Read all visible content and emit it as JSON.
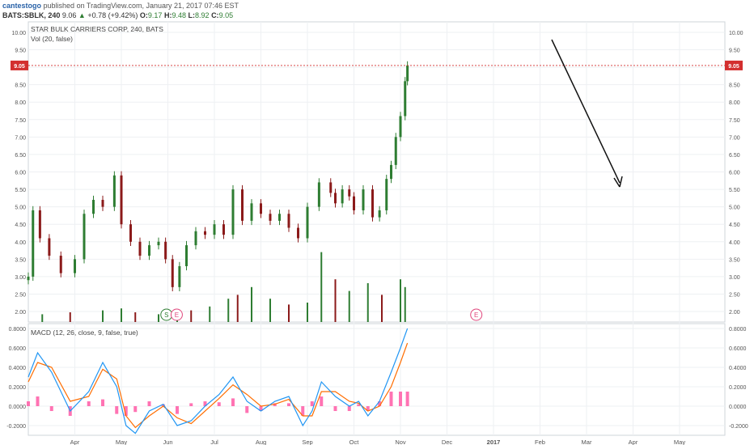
{
  "header": {
    "user": "cantestogo",
    "published": "published on TradingView.com, January 21, 2017 07:46 EST",
    "symbol": "BATS:SBLK, 240",
    "last": "9.06",
    "change": "+0.78 (+9.42%)",
    "open_label": "O:",
    "open": "9.17",
    "high_label": "H:",
    "high": "9.48",
    "low_label": "L:",
    "low": "8.92",
    "close_label": "C:",
    "close": "9.05",
    "up_icon": "triangle-up-icon"
  },
  "main_pane": {
    "title": "STAR BULK CARRIERS CORP, 240, BATS",
    "volume_label": "Vol (20, false)",
    "price_marker": "9.05"
  },
  "macd_pane": {
    "label": "MACD (12, 26, close, 9, false, true)"
  },
  "events": [
    {
      "letter": "S",
      "color": "#2e7d32",
      "x_month": 4.97
    },
    {
      "letter": "E",
      "color": "#e0467c",
      "x_month": 5.19
    },
    {
      "letter": "E",
      "color": "#e0467c",
      "x_month": 11.63
    }
  ],
  "colors": {
    "up": "#2e7d32",
    "down": "#8b1a1a",
    "macd": "#2196f3",
    "signal": "#ff6d00",
    "hist": "#ff5ba6",
    "marker": "#d32f2f"
  },
  "chart_data": [
    {
      "type": "candlestick",
      "title": "STAR BULK CARRIERS CORP, 240, BATS",
      "x_ticks": [
        "Apr",
        "May",
        "Jun",
        "Jul",
        "Aug",
        "Sep",
        "Oct",
        "Nov",
        "Dec",
        "2017",
        "Feb",
        "Mar",
        "Apr",
        "May"
      ],
      "y_ticks": [
        "2.00",
        "2.50",
        "3.00",
        "3.50",
        "4.00",
        "4.50",
        "5.00",
        "5.50",
        "6.00",
        "6.50",
        "7.00",
        "7.50",
        "8.00",
        "8.50",
        "9.00",
        "9.50",
        "10.00"
      ],
      "ylim": [
        1.7,
        10.3
      ],
      "series": [
        {
          "x_month": [
            2.0,
            2.1,
            2.25,
            2.45,
            2.7,
            3.0,
            3.2,
            3.4,
            3.6,
            3.85,
            4.0,
            4.2,
            4.4,
            4.6,
            4.8,
            4.95,
            5.1,
            5.25,
            5.4,
            5.6,
            5.8,
            6.0,
            6.2,
            6.4,
            6.6,
            6.8,
            7.0,
            7.2,
            7.4,
            7.6,
            7.8,
            8.0,
            8.25,
            8.5,
            8.6,
            8.75,
            8.9,
            9.0,
            9.2,
            9.4,
            9.55,
            9.7,
            9.8,
            9.9,
            10.0,
            10.1,
            10.15
          ],
          "close": [
            3.0,
            4.9,
            4.1,
            3.6,
            3.1,
            3.5,
            4.8,
            5.2,
            5.0,
            5.9,
            4.5,
            4.0,
            3.6,
            3.9,
            4.0,
            3.5,
            2.7,
            3.3,
            3.9,
            4.3,
            4.2,
            4.5,
            4.2,
            5.5,
            4.6,
            5.1,
            4.8,
            4.6,
            4.8,
            4.4,
            4.1,
            5.0,
            5.7,
            5.4,
            5.1,
            5.5,
            5.3,
            4.9,
            5.5,
            4.7,
            4.9,
            5.8,
            6.2,
            7.0,
            7.6,
            8.6,
            9.05
          ]
        }
      ]
    },
    {
      "type": "bar",
      "title": "Vol (20, false)",
      "x_month": [
        2.3,
        2.9,
        3.6,
        4.0,
        4.3,
        4.8,
        5.2,
        5.5,
        5.9,
        6.3,
        6.5,
        6.8,
        7.2,
        7.6,
        8.0,
        8.3,
        8.6,
        8.9,
        9.3,
        9.6,
        10.0,
        10.1
      ],
      "values": [
        0.2,
        0.25,
        0.3,
        0.35,
        0.25,
        0.2,
        0.25,
        0.3,
        0.4,
        0.6,
        0.7,
        0.9,
        0.6,
        0.45,
        0.5,
        1.8,
        1.1,
        0.8,
        1.0,
        0.7,
        1.1,
        0.9
      ]
    },
    {
      "type": "line",
      "title": "MACD (12, 26, close, 9, false, true)",
      "y_ticks": [
        "-0.2000",
        "0.0000",
        "0.2000",
        "0.4000",
        "0.6000",
        "0.8000"
      ],
      "ylim": [
        -0.3,
        0.85
      ],
      "x_month": [
        2.0,
        2.2,
        2.5,
        2.9,
        3.3,
        3.6,
        3.9,
        4.1,
        4.3,
        4.6,
        4.9,
        5.2,
        5.5,
        5.8,
        6.1,
        6.4,
        6.7,
        7.0,
        7.3,
        7.6,
        7.9,
        8.1,
        8.3,
        8.6,
        8.9,
        9.1,
        9.3,
        9.55,
        9.8,
        10.0,
        10.15
      ],
      "series": [
        {
          "name": "MACD",
          "values": [
            0.3,
            0.55,
            0.35,
            -0.05,
            0.15,
            0.45,
            0.2,
            -0.2,
            -0.28,
            -0.05,
            0.02,
            -0.2,
            -0.15,
            0.0,
            0.12,
            0.3,
            0.05,
            -0.05,
            0.05,
            0.1,
            -0.2,
            -0.05,
            0.25,
            0.1,
            0.0,
            0.05,
            -0.1,
            0.05,
            0.35,
            0.6,
            0.8
          ]
        },
        {
          "name": "Signal",
          "values": [
            0.25,
            0.45,
            0.4,
            0.05,
            0.1,
            0.38,
            0.28,
            -0.1,
            -0.22,
            -0.1,
            0.0,
            -0.12,
            -0.18,
            -0.05,
            0.08,
            0.22,
            0.12,
            0.0,
            0.02,
            0.07,
            -0.1,
            -0.1,
            0.15,
            0.15,
            0.05,
            0.03,
            -0.05,
            0.0,
            0.2,
            0.45,
            0.65
          ]
        },
        {
          "name": "Histogram",
          "values": [
            0.05,
            0.1,
            -0.05,
            -0.1,
            0.05,
            0.07,
            -0.08,
            -0.1,
            -0.06,
            0.05,
            0.02,
            -0.08,
            0.03,
            0.05,
            0.04,
            0.08,
            -0.07,
            -0.05,
            0.03,
            0.03,
            -0.1,
            0.05,
            0.1,
            -0.05,
            -0.05,
            0.02,
            -0.05,
            0.05,
            0.15,
            0.15,
            0.15
          ]
        }
      ]
    }
  ]
}
